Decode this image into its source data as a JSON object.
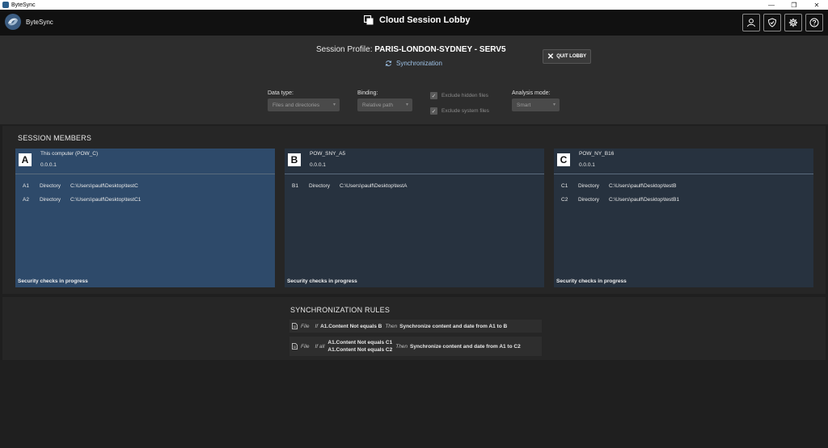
{
  "window": {
    "title": "ByteSync",
    "minimize": "—",
    "maximize": "❐",
    "close": "✕"
  },
  "header": {
    "app_name": "ByteSync",
    "title": "Cloud Session Lobby",
    "buttons": [
      "profile",
      "security",
      "settings",
      "help"
    ]
  },
  "profile": {
    "label": "Session Profile:",
    "name": "PARIS-LONDON-SYDNEY - SERV5",
    "mode": "Synchronization",
    "quit_label": "QUIT LOBBY",
    "options": {
      "data_type": {
        "label": "Data type:",
        "value": "Files and directories"
      },
      "binding": {
        "label": "Binding:",
        "value": "Relative path"
      },
      "exclude_hidden": {
        "label": "Exclude hidden files",
        "checked": true
      },
      "exclude_system": {
        "label": "Exclude system files",
        "checked": true
      },
      "analysis_mode": {
        "label": "Analysis mode:",
        "value": "Smart"
      }
    }
  },
  "members": {
    "title": "SESSION MEMBERS",
    "cards": [
      {
        "letter": "A",
        "name": "This computer (POW_C)",
        "address": "0.0.0.1",
        "local": true,
        "parts": [
          {
            "code": "A1",
            "kind": "Directory",
            "path": "C:\\Users\\paulf\\Desktop\\testC"
          },
          {
            "code": "A2",
            "kind": "Directory",
            "path": "C:\\Users\\paulf\\Desktop\\testC1"
          }
        ],
        "status": "Security checks in progress"
      },
      {
        "letter": "B",
        "name": "POW_SNY_A5",
        "address": "0.0.0.1",
        "local": false,
        "parts": [
          {
            "code": "B1",
            "kind": "Directory",
            "path": "C:\\Users\\paulf\\Desktop\\testA"
          }
        ],
        "status": "Security checks in progress"
      },
      {
        "letter": "C",
        "name": "POW_NY_B16",
        "address": "0.0.0.1",
        "local": false,
        "parts": [
          {
            "code": "C1",
            "kind": "Directory",
            "path": "C:\\Users\\paulf\\Desktop\\testB"
          },
          {
            "code": "C2",
            "kind": "Directory",
            "path": "C:\\Users\\paulf\\Desktop\\testB1"
          }
        ],
        "status": "Security checks in progress"
      }
    ]
  },
  "rules": {
    "title": "SYNCHRONIZATION RULES",
    "items": [
      {
        "scope": "File",
        "if_word": "If",
        "conditions": [
          "A1.Content Not equals B"
        ],
        "then_word": "Then",
        "action": "Synchronize content and date from A1 to B"
      },
      {
        "scope": "File",
        "if_word": "If all",
        "conditions": [
          "A1.Content Not equals C1",
          "A1.Content Not equals C2"
        ],
        "then_word": "Then",
        "action": "Synchronize content and date from A1 to C2"
      }
    ]
  },
  "colors": {
    "accent": "#9fc3e8",
    "local_card": "#2e4a6a",
    "remote_card": "#27323f",
    "background": "#1f1f1f"
  }
}
